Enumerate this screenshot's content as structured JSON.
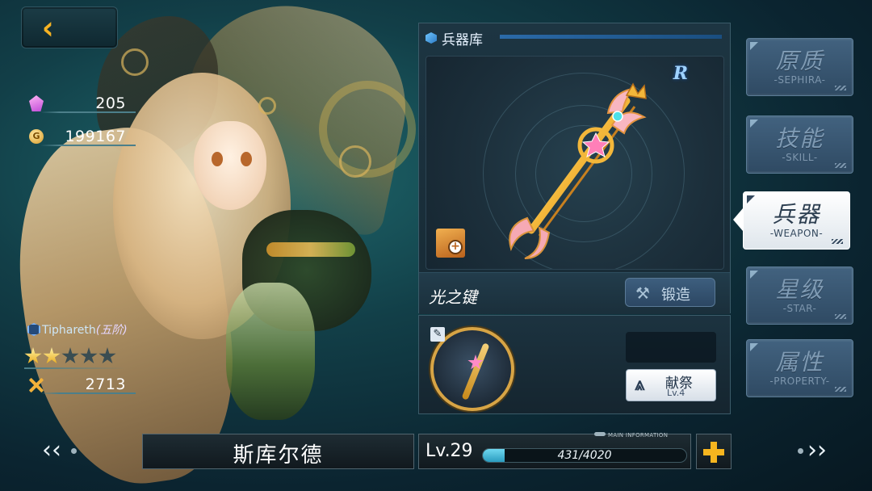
{
  "back": {
    "label": "‹"
  },
  "currencies": {
    "crystals": "205",
    "gold": "199167",
    "gold_glyph": "G"
  },
  "character": {
    "rank_name": "Tiphareth",
    "rank_tier": "(五阶)",
    "stars_total": 5,
    "stars_filled": 2,
    "power": "2713",
    "name": "斯库尔德",
    "level": "Lv.29",
    "xp_text": "431/4020",
    "xp_current": 431,
    "xp_max": 4020
  },
  "bottom": {
    "main_info": "MAIN INFORMATION"
  },
  "weapon_panel": {
    "title": "兵器库",
    "rarity": "R",
    "weapon_name": "光之键",
    "forge_label": "锻造",
    "offer_label": "献祭",
    "offer_level": "Lv.4"
  },
  "tabs": [
    {
      "cn": "原质",
      "en": "-SEPHIRA-"
    },
    {
      "cn": "技能",
      "en": "-SKILL-"
    },
    {
      "cn": "兵器",
      "en": "-WEAPON-",
      "active": true
    },
    {
      "cn": "星级",
      "en": "-STAR-"
    },
    {
      "cn": "属性",
      "en": "-PROPERTY-"
    }
  ],
  "icons": {
    "back": "back-chevron-icon",
    "crystal": "crystal-icon",
    "gold": "gold-coin-icon",
    "rank": "hexagon-rank-icon",
    "power": "crossed-swords-icon",
    "panel": "cube-icon",
    "zoom": "zoom-document-icon",
    "forge": "hammer-icon",
    "offer": "offering-icon",
    "edit": "edit-icon",
    "prev": "prev-arrow-icon",
    "next": "next-arrow-icon",
    "add": "plus-icon"
  },
  "colors": {
    "accent": "#f5b223",
    "star_on": "#e8a816",
    "xp_fill": "#2b9cbf",
    "tab_active_bg": "#ffffff",
    "rarity": "#9fd2ff"
  }
}
